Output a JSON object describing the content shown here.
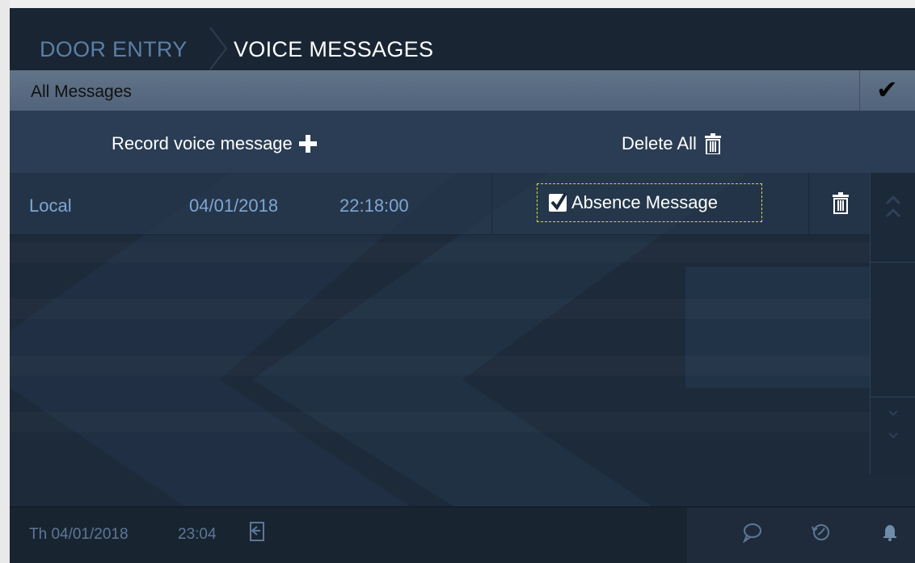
{
  "header": {
    "breadcrumb_parent": "DOOR ENTRY",
    "breadcrumb_current": "VOICE MESSAGES"
  },
  "filter": {
    "selected": "All Messages",
    "confirm_icon": "checkmark-icon"
  },
  "actions": {
    "record_label": "Record voice message",
    "record_icon": "plus-icon",
    "delete_all_label": "Delete All",
    "delete_all_icon": "trash-icon"
  },
  "messages": [
    {
      "source": "Local",
      "date": "04/01/2018",
      "time": "22:18:00",
      "absence_label": "Absence Message",
      "absence_checked": true
    }
  ],
  "footer": {
    "day_date": "Th 04/01/2018",
    "time": "23:04",
    "icons": [
      "exit-icon",
      "chat-icon",
      "history-icon",
      "bell-icon"
    ]
  },
  "colors": {
    "accent_text": "#7fa6d2",
    "focus_border": "#d8d842",
    "background": "#1d2a3a"
  }
}
